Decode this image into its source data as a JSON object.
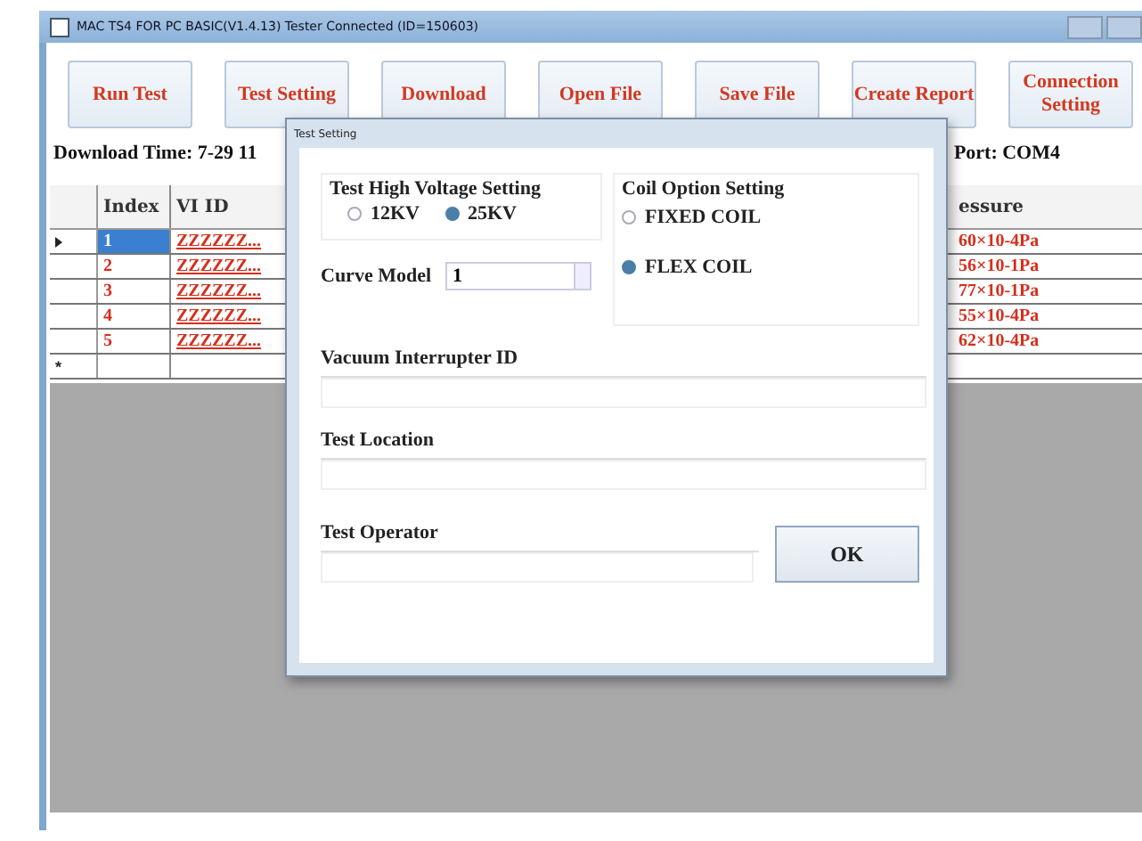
{
  "window": {
    "title": "MAC TS4 FOR PC BASIC(V1.4.13) Tester Connected (ID=150603)"
  },
  "toolbar": [
    "Run Test",
    "Test Setting",
    "Download",
    "Open File",
    "Save File",
    "Create Report",
    "Connection Setting"
  ],
  "info": {
    "download_time": "Download Time: 7-29  11",
    "port": "Port: COM4"
  },
  "table": {
    "columns": [
      "Index",
      "VI  ID"
    ],
    "column_last": "essure",
    "rows": [
      {
        "selected": true,
        "index": "1",
        "vi_id": "ZZZZZZ...",
        "pressure": "60×10-4Pa"
      },
      {
        "selected": false,
        "index": "2",
        "vi_id": "ZZZZZZ...",
        "pressure": "56×10-1Pa"
      },
      {
        "selected": false,
        "index": "3",
        "vi_id": "ZZZZZZ...",
        "pressure": "77×10-1Pa"
      },
      {
        "selected": false,
        "index": "4",
        "vi_id": "ZZZZZZ...",
        "pressure": "55×10-4Pa"
      },
      {
        "selected": false,
        "index": "5",
        "vi_id": "ZZZZZZ...",
        "pressure": "62×10-4Pa"
      }
    ],
    "new_row_marker": "*"
  },
  "dialog": {
    "title": "Test Setting",
    "voltage": {
      "label": "Test High Voltage Setting",
      "options": [
        {
          "label": "12KV",
          "selected": false
        },
        {
          "label": "25KV",
          "selected": true
        }
      ]
    },
    "coil": {
      "label": "Coil Option Setting",
      "options": [
        {
          "label": "FIXED COIL",
          "selected": false
        },
        {
          "label": "FLEX COIL",
          "selected": true
        }
      ]
    },
    "curve_model": {
      "label": "Curve Model",
      "value": "1"
    },
    "fields": [
      {
        "label": "Vacuum Interrupter ID"
      },
      {
        "label": "Test Location"
      },
      {
        "label": "Test Operator"
      }
    ],
    "ok": "OK"
  }
}
